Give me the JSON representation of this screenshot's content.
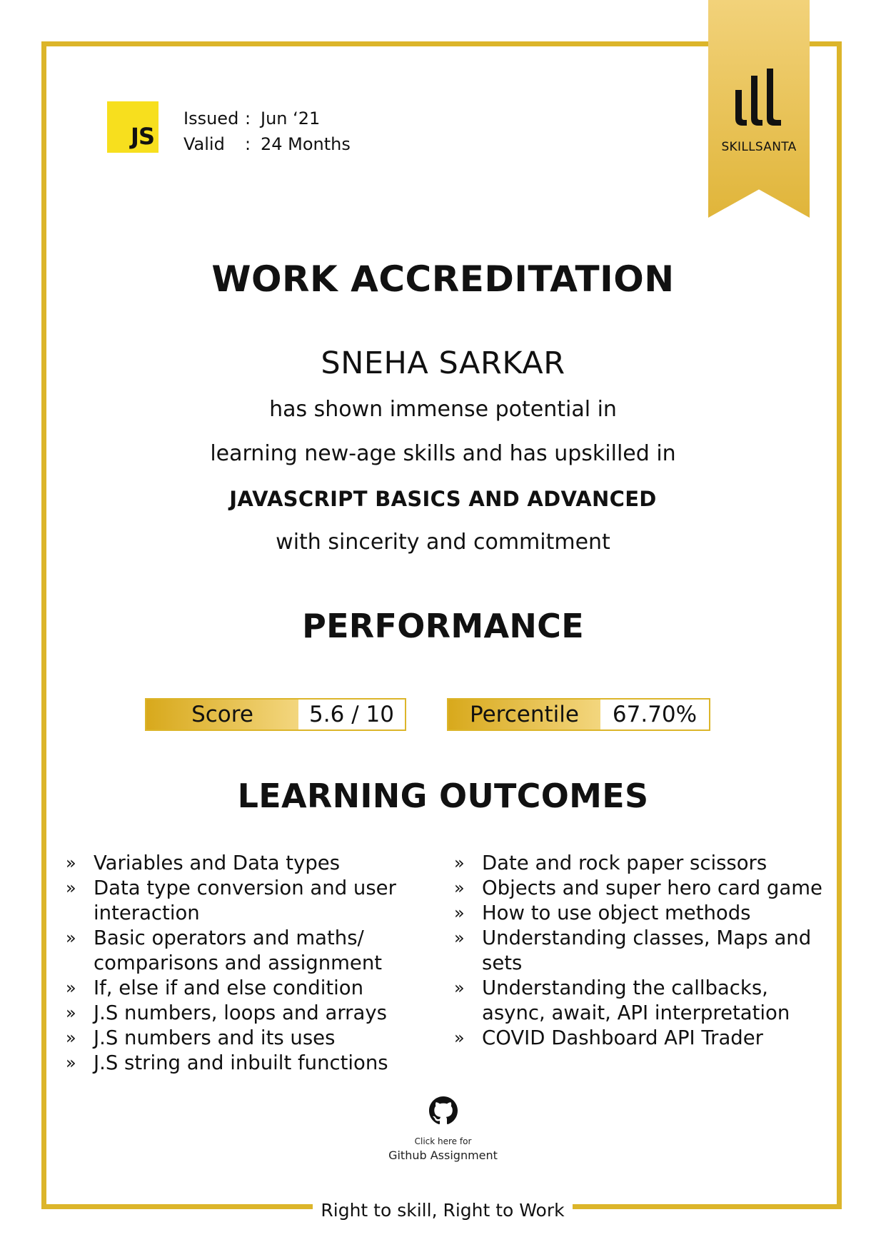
{
  "brand": {
    "name": "SKILLSANTA",
    "logo_icon": "skillsanta-bars-logo",
    "accent_color": "#dcb52a"
  },
  "badge": {
    "text": "JS",
    "color": "#f7df1e"
  },
  "meta": {
    "issued_label": "Issued",
    "issued_value": "Jun ‘21",
    "valid_label": "Valid",
    "valid_value": "24 Months",
    "separator": ":"
  },
  "title": "WORK ACCREDITATION",
  "recipient": "SNEHA SARKAR",
  "body": {
    "line1": "has shown immense potential in",
    "line2": "learning new-age skills and has upskilled in",
    "skill": "JAVASCRIPT BASICS AND ADVANCED",
    "line3": "with sincerity and commitment"
  },
  "performance": {
    "heading": "PERFORMANCE",
    "score_label": "Score",
    "score_value": "5.6 / 10",
    "percentile_label": "Percentile",
    "percentile_value": "67.70%"
  },
  "learning": {
    "heading": "LEARNING OUTCOMES",
    "bullet": "»",
    "left": [
      "Variables and Data types",
      "Data type conversion and user interaction",
      "Basic operators and maths/ comparisons and assignment",
      "If, else if and else condition",
      "J.S numbers, loops and arrays",
      "J.S numbers and its uses",
      "J.S string and inbuilt functions"
    ],
    "right": [
      "Date and rock paper scissors",
      "Objects and super hero card game",
      "How to use object methods",
      "Understanding classes, Maps and sets",
      "Understanding the callbacks, async, await, API interpretation",
      "COVID Dashboard API Trader"
    ]
  },
  "github": {
    "icon": "github-icon",
    "small": "Click here for",
    "label": "Github Assignment"
  },
  "tagline": "Right to skill, Right to Work"
}
